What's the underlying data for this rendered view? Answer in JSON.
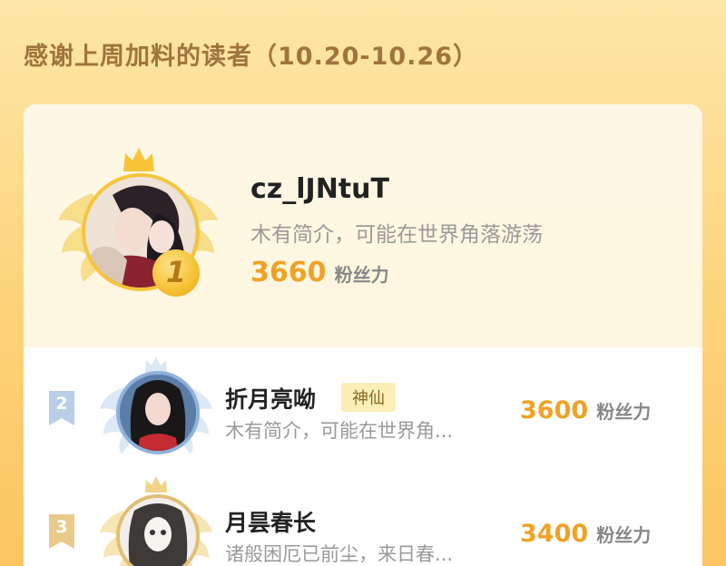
{
  "header": {
    "title": "感谢上周加料的读者（10.20-10.26）"
  },
  "top_fan": {
    "rank": "1",
    "name": "cz_lJNtuT",
    "bio": "木有简介，可能在世界角落游荡",
    "fans_value": "3660",
    "fans_unit": "粉丝力",
    "avatar_icon": "anime-couple-avatar"
  },
  "list": [
    {
      "rank": "2",
      "name": "折月亮呦",
      "tag": "神仙",
      "bio": "木有简介，可能在世界角...",
      "fans_value": "3600",
      "fans_unit": "粉丝力",
      "avatar_icon": "anime-girl-avatar"
    },
    {
      "rank": "3",
      "name": "月昙春长",
      "bio": "诸般困厄已前尘，来日春...",
      "fans_value": "3400",
      "fans_unit": "粉丝力",
      "avatar_icon": "sketch-girl-avatar"
    }
  ],
  "colors": {
    "accent": "#f0a227",
    "title": "#a0743e",
    "gold": "#f5c542",
    "silver": "#b8cfe8",
    "bronze": "#e8c98a"
  }
}
